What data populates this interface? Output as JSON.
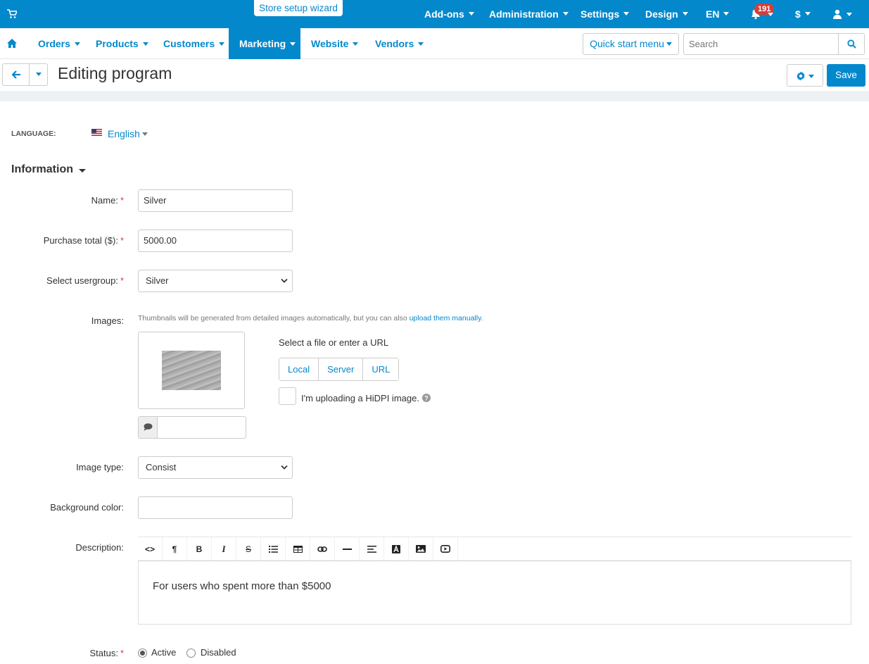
{
  "topbar": {
    "wizard_label": "Store setup wizard",
    "nav": [
      "Add-ons",
      "Administration",
      "Settings",
      "Design",
      "EN"
    ],
    "notifications_count": "191",
    "currency": "$"
  },
  "navbar": {
    "items": [
      "Orders",
      "Products",
      "Customers",
      "Marketing",
      "Website",
      "Vendors"
    ],
    "active": "Marketing",
    "quick_start": "Quick start menu",
    "search_placeholder": "Search"
  },
  "titlebar": {
    "title": "Editing program",
    "save_label": "Save"
  },
  "language": {
    "label": "LANGUAGE:",
    "value": "English"
  },
  "section": {
    "title": "Information"
  },
  "form": {
    "name_label": "Name:",
    "name_value": "Silver",
    "purchase_label": "Purchase total ($):",
    "purchase_value": "5000.00",
    "usergroup_label": "Select usergroup:",
    "usergroup_value": "Silver",
    "images_label": "Images:",
    "images_hint": "Thumbnails will be generated from detailed images automatically, but you can also ",
    "images_hint_link": "upload them manually",
    "file_title": "Select a file or enter a URL",
    "source_buttons": [
      "Local",
      "Server",
      "URL"
    ],
    "hidpi_label": "I'm uploading a HiDPI image.",
    "image_type_label": "Image type:",
    "image_type_value": "Consist",
    "bg_color_label": "Background color:",
    "bg_color_value": "",
    "description_label": "Description:",
    "description_text": "For users who spent more than $5000",
    "status_label": "Status:",
    "status_options": [
      "Active",
      "Disabled"
    ],
    "status_value": "Active"
  },
  "colors": {
    "accent": "#0388cc",
    "required": "#d43f3a"
  }
}
